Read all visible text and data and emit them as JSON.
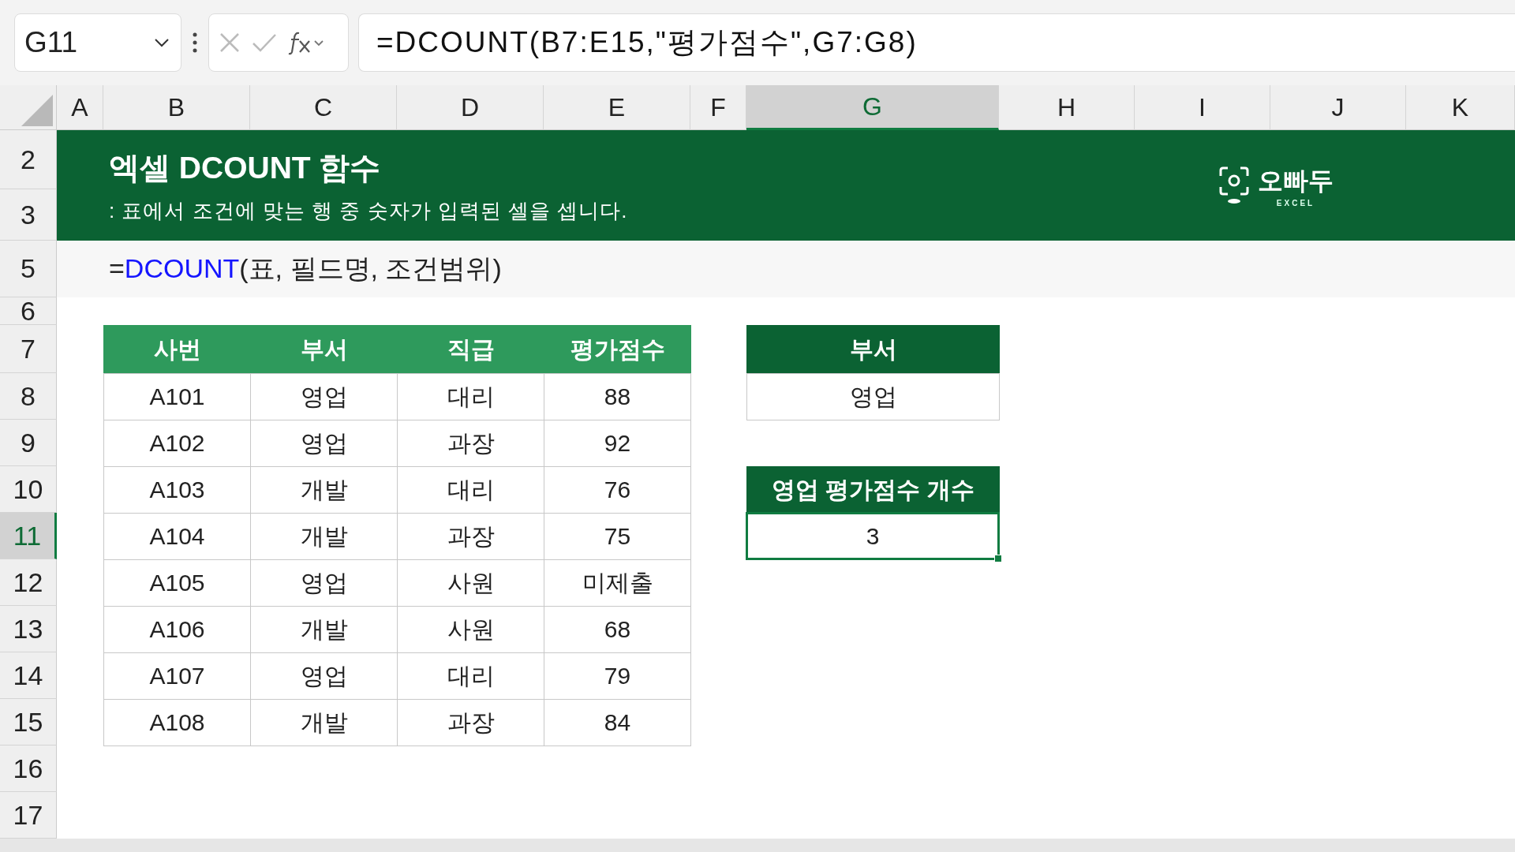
{
  "name_box": "G11",
  "formula": "=DCOUNT(B7:E15,\"평가점수\",G7:G8)",
  "columns": [
    {
      "label": "A",
      "selected": false
    },
    {
      "label": "B",
      "selected": false
    },
    {
      "label": "C",
      "selected": false
    },
    {
      "label": "D",
      "selected": false
    },
    {
      "label": "E",
      "selected": false
    },
    {
      "label": "F",
      "selected": false
    },
    {
      "label": "G",
      "selected": true
    },
    {
      "label": "H",
      "selected": false
    },
    {
      "label": "I",
      "selected": false
    },
    {
      "label": "J",
      "selected": false
    },
    {
      "label": "K",
      "selected": false
    }
  ],
  "rows": [
    {
      "label": "2",
      "selected": false
    },
    {
      "label": "3",
      "selected": false
    },
    {
      "label": "5",
      "selected": false
    },
    {
      "label": "6",
      "selected": false
    },
    {
      "label": "7",
      "selected": false
    },
    {
      "label": "8",
      "selected": false
    },
    {
      "label": "9",
      "selected": false
    },
    {
      "label": "10",
      "selected": false
    },
    {
      "label": "11",
      "selected": true
    },
    {
      "label": "12",
      "selected": false
    },
    {
      "label": "13",
      "selected": false
    },
    {
      "label": "14",
      "selected": false
    },
    {
      "label": "15",
      "selected": false
    },
    {
      "label": "16",
      "selected": false
    },
    {
      "label": "17",
      "selected": false
    }
  ],
  "banner": {
    "title": "엑셀 DCOUNT 함수",
    "subtitle": ": 표에서 조건에 맞는 행 중 숫자가 입력된 셀을 셉니다.",
    "logo_name": "오빠두",
    "logo_sub": "EXCEL"
  },
  "syntax": {
    "prefix": "=",
    "function": "DCOUNT",
    "args": "(표, 필드명, 조건범위)"
  },
  "table": {
    "columns": [
      "사번",
      "부서",
      "직급",
      "평가점수"
    ],
    "rows": [
      [
        "A101",
        "영업",
        "대리",
        "88"
      ],
      [
        "A102",
        "영업",
        "과장",
        "92"
      ],
      [
        "A103",
        "개발",
        "대리",
        "76"
      ],
      [
        "A104",
        "개발",
        "과장",
        "75"
      ],
      [
        "A105",
        "영업",
        "사원",
        "미제출"
      ],
      [
        "A106",
        "개발",
        "사원",
        "68"
      ],
      [
        "A107",
        "영업",
        "대리",
        "79"
      ],
      [
        "A108",
        "개발",
        "과장",
        "84"
      ]
    ]
  },
  "criteria": {
    "header": "부서",
    "value": "영업"
  },
  "result": {
    "header": "영업 평가점수 개수",
    "value": "3"
  }
}
